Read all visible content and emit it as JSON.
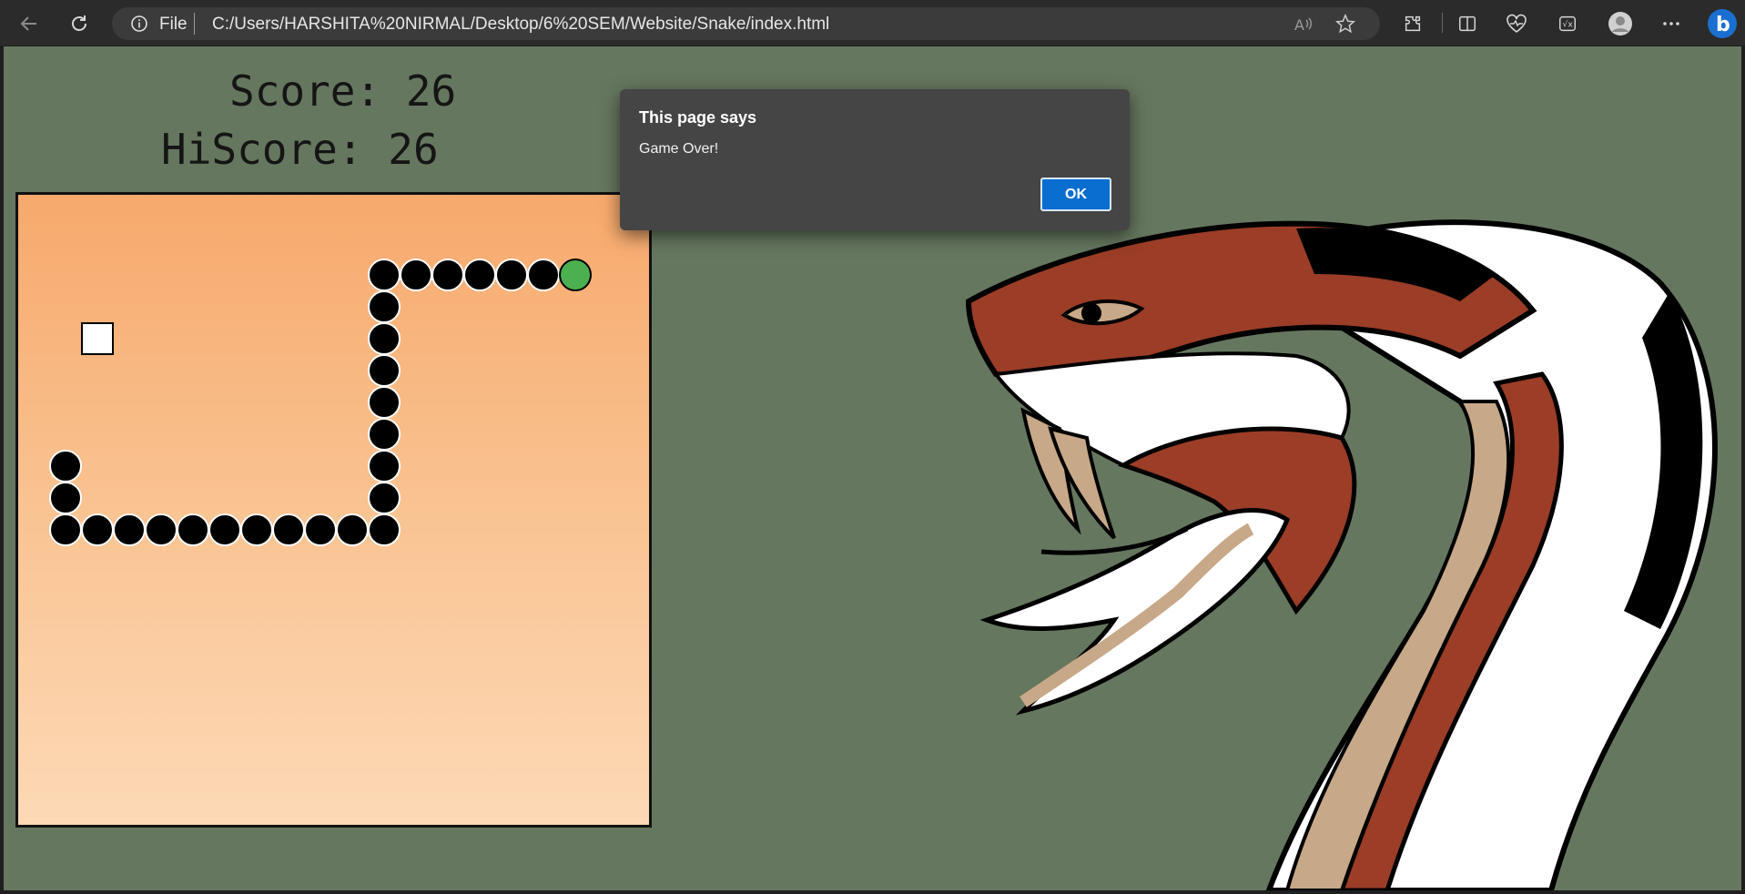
{
  "browser": {
    "address_scheme": "File",
    "url": "C:/Users/HARSHITA%20NIRMAL/Desktop/6%20SEM/Website/Snake/index.html"
  },
  "game": {
    "score_text": "Score: 26",
    "hiscore_text": "HiScore: 26",
    "colors": {
      "background": "#66775f",
      "board_top": "#f7a96c",
      "board_bottom": "#fdd9b6",
      "snake_body": "#000000",
      "snake_head": "#4caf50",
      "food": "#ffffff"
    }
  },
  "dialog": {
    "title": "This page says",
    "message": "Game Over!",
    "ok_label": "OK"
  }
}
